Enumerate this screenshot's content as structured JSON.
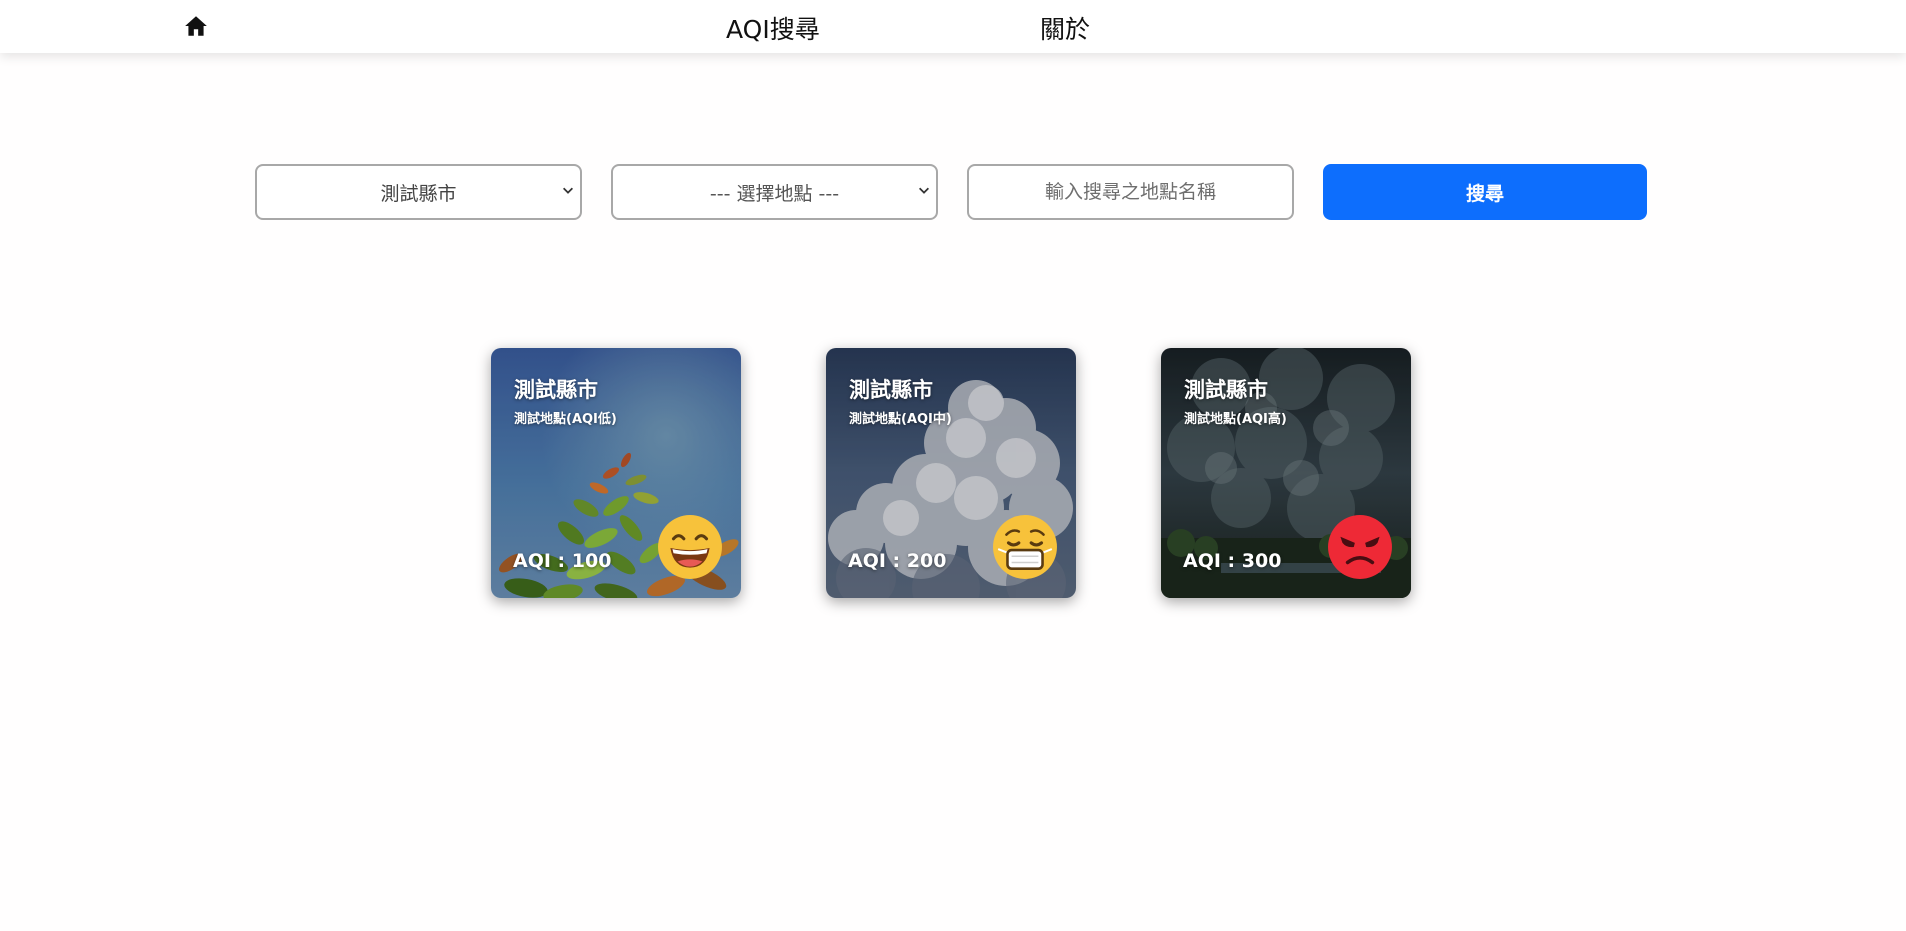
{
  "nav": {
    "home_icon": "home-icon",
    "aqi_search": "AQI搜尋",
    "about": "關於"
  },
  "search": {
    "county_selected": "測試縣市",
    "site_selected": "--- 選擇地點 ---",
    "name_placeholder": "輸入搜尋之地點名稱",
    "button_label": "搜尋"
  },
  "cards": [
    {
      "county": "測試縣市",
      "site": "測試地點(AQI低)",
      "aqi_text": "AQI : 100",
      "aqi": 100,
      "emoji": "grinning-face-icon",
      "emoji_color": "#f7c23b"
    },
    {
      "county": "測試縣市",
      "site": "測試地點(AQI中)",
      "aqi_text": "AQI : 200",
      "aqi": 200,
      "emoji": "mask-face-icon",
      "emoji_color": "#f7c23b"
    },
    {
      "county": "測試縣市",
      "site": "測試地點(AQI高)",
      "aqi_text": "AQI : 300",
      "aqi": 300,
      "emoji": "angry-face-icon",
      "emoji_color": "#ee2936"
    }
  ],
  "colors": {
    "primary_button": "#0d6efd",
    "navbar_bg": "#ffffff"
  }
}
